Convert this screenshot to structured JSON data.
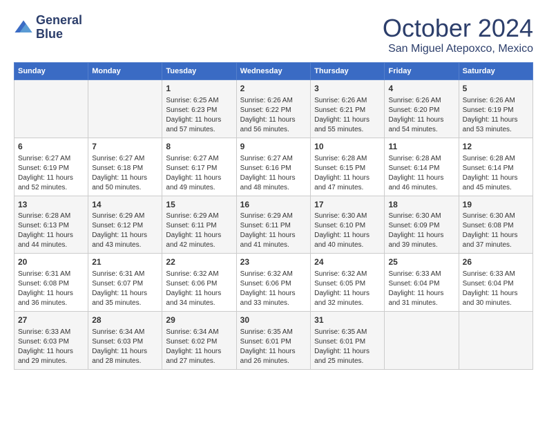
{
  "header": {
    "logo_line1": "General",
    "logo_line2": "Blue",
    "month": "October 2024",
    "location": "San Miguel Atepoxco, Mexico"
  },
  "days_of_week": [
    "Sunday",
    "Monday",
    "Tuesday",
    "Wednesday",
    "Thursday",
    "Friday",
    "Saturday"
  ],
  "weeks": [
    [
      {
        "day": "",
        "sunrise": "",
        "sunset": "",
        "daylight": ""
      },
      {
        "day": "",
        "sunrise": "",
        "sunset": "",
        "daylight": ""
      },
      {
        "day": "1",
        "sunrise": "Sunrise: 6:25 AM",
        "sunset": "Sunset: 6:23 PM",
        "daylight": "Daylight: 11 hours and 57 minutes."
      },
      {
        "day": "2",
        "sunrise": "Sunrise: 6:26 AM",
        "sunset": "Sunset: 6:22 PM",
        "daylight": "Daylight: 11 hours and 56 minutes."
      },
      {
        "day": "3",
        "sunrise": "Sunrise: 6:26 AM",
        "sunset": "Sunset: 6:21 PM",
        "daylight": "Daylight: 11 hours and 55 minutes."
      },
      {
        "day": "4",
        "sunrise": "Sunrise: 6:26 AM",
        "sunset": "Sunset: 6:20 PM",
        "daylight": "Daylight: 11 hours and 54 minutes."
      },
      {
        "day": "5",
        "sunrise": "Sunrise: 6:26 AM",
        "sunset": "Sunset: 6:19 PM",
        "daylight": "Daylight: 11 hours and 53 minutes."
      }
    ],
    [
      {
        "day": "6",
        "sunrise": "Sunrise: 6:27 AM",
        "sunset": "Sunset: 6:19 PM",
        "daylight": "Daylight: 11 hours and 52 minutes."
      },
      {
        "day": "7",
        "sunrise": "Sunrise: 6:27 AM",
        "sunset": "Sunset: 6:18 PM",
        "daylight": "Daylight: 11 hours and 50 minutes."
      },
      {
        "day": "8",
        "sunrise": "Sunrise: 6:27 AM",
        "sunset": "Sunset: 6:17 PM",
        "daylight": "Daylight: 11 hours and 49 minutes."
      },
      {
        "day": "9",
        "sunrise": "Sunrise: 6:27 AM",
        "sunset": "Sunset: 6:16 PM",
        "daylight": "Daylight: 11 hours and 48 minutes."
      },
      {
        "day": "10",
        "sunrise": "Sunrise: 6:28 AM",
        "sunset": "Sunset: 6:15 PM",
        "daylight": "Daylight: 11 hours and 47 minutes."
      },
      {
        "day": "11",
        "sunrise": "Sunrise: 6:28 AM",
        "sunset": "Sunset: 6:14 PM",
        "daylight": "Daylight: 11 hours and 46 minutes."
      },
      {
        "day": "12",
        "sunrise": "Sunrise: 6:28 AM",
        "sunset": "Sunset: 6:14 PM",
        "daylight": "Daylight: 11 hours and 45 minutes."
      }
    ],
    [
      {
        "day": "13",
        "sunrise": "Sunrise: 6:28 AM",
        "sunset": "Sunset: 6:13 PM",
        "daylight": "Daylight: 11 hours and 44 minutes."
      },
      {
        "day": "14",
        "sunrise": "Sunrise: 6:29 AM",
        "sunset": "Sunset: 6:12 PM",
        "daylight": "Daylight: 11 hours and 43 minutes."
      },
      {
        "day": "15",
        "sunrise": "Sunrise: 6:29 AM",
        "sunset": "Sunset: 6:11 PM",
        "daylight": "Daylight: 11 hours and 42 minutes."
      },
      {
        "day": "16",
        "sunrise": "Sunrise: 6:29 AM",
        "sunset": "Sunset: 6:11 PM",
        "daylight": "Daylight: 11 hours and 41 minutes."
      },
      {
        "day": "17",
        "sunrise": "Sunrise: 6:30 AM",
        "sunset": "Sunset: 6:10 PM",
        "daylight": "Daylight: 11 hours and 40 minutes."
      },
      {
        "day": "18",
        "sunrise": "Sunrise: 6:30 AM",
        "sunset": "Sunset: 6:09 PM",
        "daylight": "Daylight: 11 hours and 39 minutes."
      },
      {
        "day": "19",
        "sunrise": "Sunrise: 6:30 AM",
        "sunset": "Sunset: 6:08 PM",
        "daylight": "Daylight: 11 hours and 37 minutes."
      }
    ],
    [
      {
        "day": "20",
        "sunrise": "Sunrise: 6:31 AM",
        "sunset": "Sunset: 6:08 PM",
        "daylight": "Daylight: 11 hours and 36 minutes."
      },
      {
        "day": "21",
        "sunrise": "Sunrise: 6:31 AM",
        "sunset": "Sunset: 6:07 PM",
        "daylight": "Daylight: 11 hours and 35 minutes."
      },
      {
        "day": "22",
        "sunrise": "Sunrise: 6:32 AM",
        "sunset": "Sunset: 6:06 PM",
        "daylight": "Daylight: 11 hours and 34 minutes."
      },
      {
        "day": "23",
        "sunrise": "Sunrise: 6:32 AM",
        "sunset": "Sunset: 6:06 PM",
        "daylight": "Daylight: 11 hours and 33 minutes."
      },
      {
        "day": "24",
        "sunrise": "Sunrise: 6:32 AM",
        "sunset": "Sunset: 6:05 PM",
        "daylight": "Daylight: 11 hours and 32 minutes."
      },
      {
        "day": "25",
        "sunrise": "Sunrise: 6:33 AM",
        "sunset": "Sunset: 6:04 PM",
        "daylight": "Daylight: 11 hours and 31 minutes."
      },
      {
        "day": "26",
        "sunrise": "Sunrise: 6:33 AM",
        "sunset": "Sunset: 6:04 PM",
        "daylight": "Daylight: 11 hours and 30 minutes."
      }
    ],
    [
      {
        "day": "27",
        "sunrise": "Sunrise: 6:33 AM",
        "sunset": "Sunset: 6:03 PM",
        "daylight": "Daylight: 11 hours and 29 minutes."
      },
      {
        "day": "28",
        "sunrise": "Sunrise: 6:34 AM",
        "sunset": "Sunset: 6:03 PM",
        "daylight": "Daylight: 11 hours and 28 minutes."
      },
      {
        "day": "29",
        "sunrise": "Sunrise: 6:34 AM",
        "sunset": "Sunset: 6:02 PM",
        "daylight": "Daylight: 11 hours and 27 minutes."
      },
      {
        "day": "30",
        "sunrise": "Sunrise: 6:35 AM",
        "sunset": "Sunset: 6:01 PM",
        "daylight": "Daylight: 11 hours and 26 minutes."
      },
      {
        "day": "31",
        "sunrise": "Sunrise: 6:35 AM",
        "sunset": "Sunset: 6:01 PM",
        "daylight": "Daylight: 11 hours and 25 minutes."
      },
      {
        "day": "",
        "sunrise": "",
        "sunset": "",
        "daylight": ""
      },
      {
        "day": "",
        "sunrise": "",
        "sunset": "",
        "daylight": ""
      }
    ]
  ]
}
